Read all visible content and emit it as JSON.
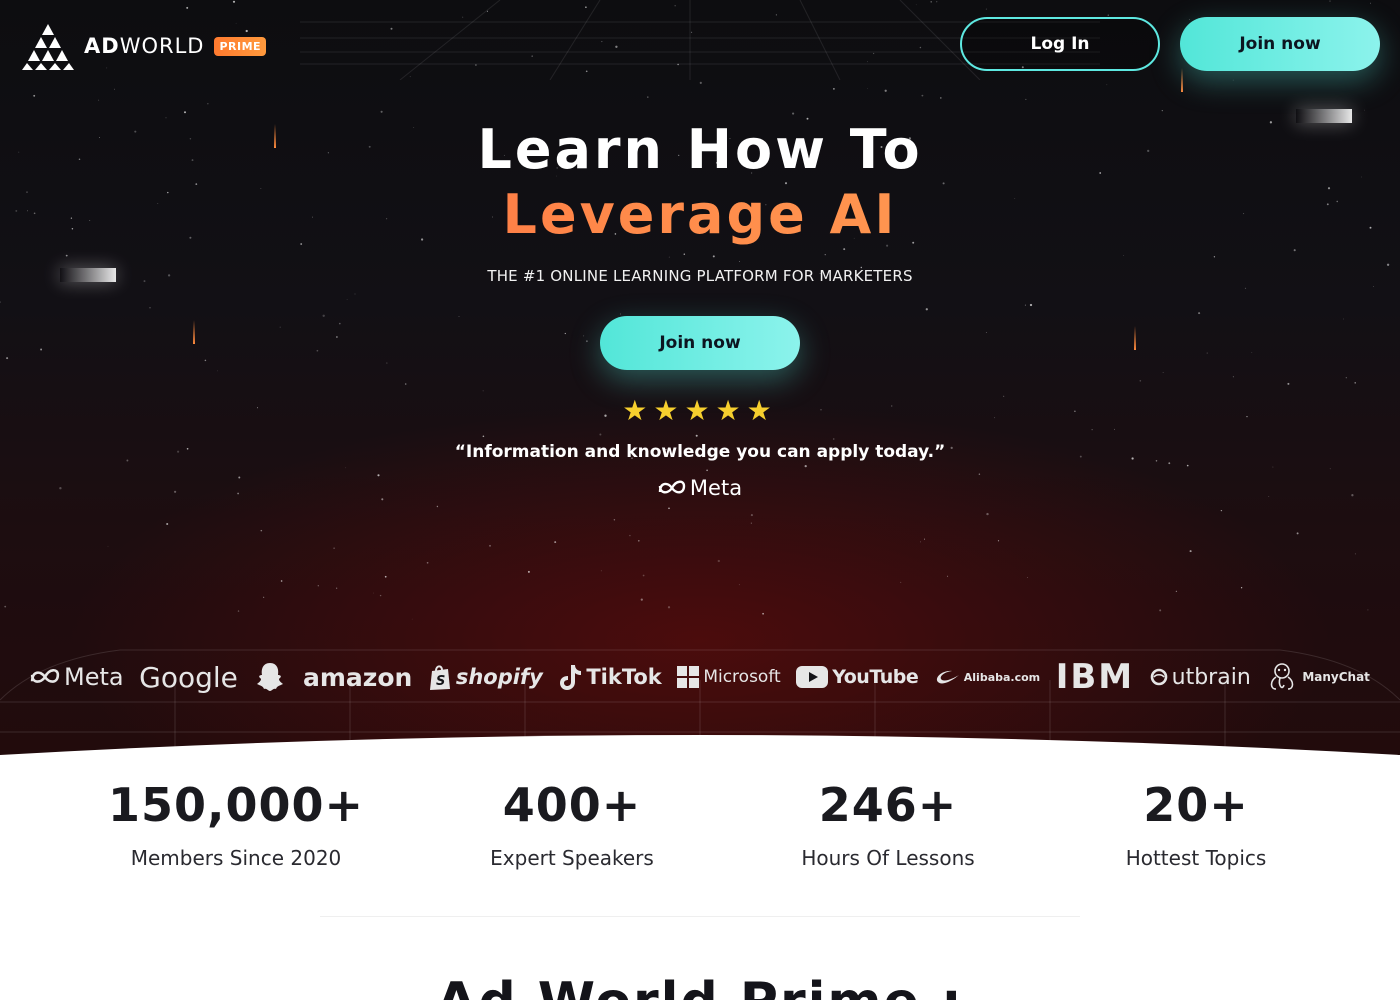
{
  "header": {
    "logo_bold": "AD",
    "logo_light": "WORLD",
    "badge": "PRIME",
    "login_label": "Log In",
    "join_label": "Join now"
  },
  "hero": {
    "headline_line1": "Learn How To",
    "headline_line2": "Leverage AI",
    "subheadline": "THE #1 ONLINE LEARNING PLATFORM FOR MARKETERS",
    "cta_label": "Join now",
    "rating_stars": "★★★★★",
    "rating_count": 5,
    "quote": "“Information and knowledge you can apply today.”",
    "quote_source": "Meta"
  },
  "brands": [
    {
      "name": "Meta",
      "icon": "meta-infinity-icon"
    },
    {
      "name": "Google"
    },
    {
      "name": "",
      "icon": "snapchat-ghost-icon"
    },
    {
      "name": "amazon"
    },
    {
      "name": "shopify",
      "icon": "shopify-bag-icon"
    },
    {
      "name": "TikTok",
      "icon": "tiktok-note-icon"
    },
    {
      "name": "Microsoft",
      "icon": "microsoft-windows-icon"
    },
    {
      "name": "YouTube",
      "icon": "youtube-play-icon"
    },
    {
      "name": "Alibaba.com",
      "icon": "alibaba-icon"
    },
    {
      "name": "IBM"
    },
    {
      "name": "utbrain",
      "icon": "outbrain-o-icon"
    },
    {
      "name": "ManyChat",
      "icon": "manychat-icon"
    }
  ],
  "stats": [
    {
      "value": "150,000+",
      "label": "Members Since 2020"
    },
    {
      "value": "400+",
      "label": "Expert Speakers"
    },
    {
      "value": "246+",
      "label": "Hours Of Lessons"
    },
    {
      "value": "20+",
      "label": "Hottest Topics"
    }
  ],
  "next_section": {
    "heading": "Ad World Prime :"
  },
  "colors": {
    "accent_teal": "#52e6d8",
    "accent_orange": "#ff7a2f",
    "star_yellow": "#f6cf2e",
    "hero_bg": "#0d0d10"
  }
}
